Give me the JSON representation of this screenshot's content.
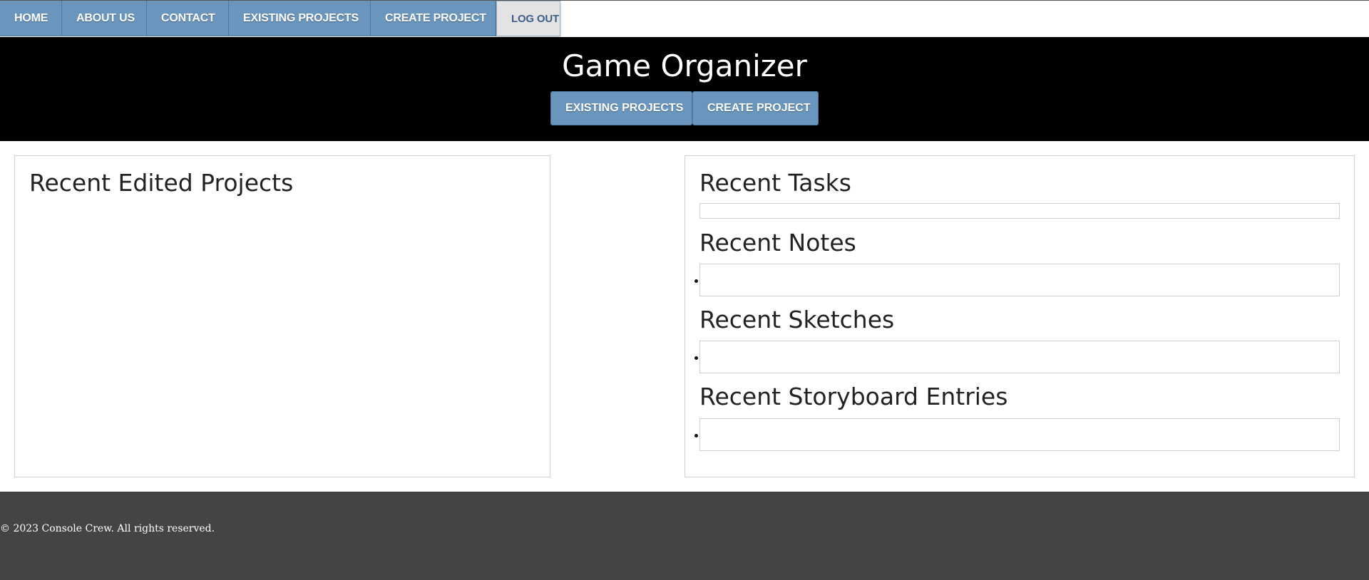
{
  "nav": {
    "items": [
      {
        "label": "HOME"
      },
      {
        "label": "ABOUT US"
      },
      {
        "label": "CONTACT"
      },
      {
        "label": "EXISTING PROJECTS"
      },
      {
        "label": "CREATE PROJECT"
      }
    ],
    "logout_label": "LOG OUT"
  },
  "hero": {
    "title": "Game Organizer",
    "existing_label": "EXISTING PROJECTS",
    "create_label": "CREATE PROJECT"
  },
  "left_panel": {
    "title": "Recent Edited Projects"
  },
  "right_panel": {
    "tasks_title": "Recent Tasks",
    "notes_title": "Recent Notes",
    "sketches_title": "Recent Sketches",
    "storyboard_title": "Recent Storyboard Entries"
  },
  "footer": {
    "text": "© 2023 Console Crew. All rights reserved."
  },
  "colors": {
    "nav_button": "#6a96bd",
    "hero_background": "#000000",
    "footer_background": "#444444",
    "logout_background": "#e3e3e3"
  }
}
